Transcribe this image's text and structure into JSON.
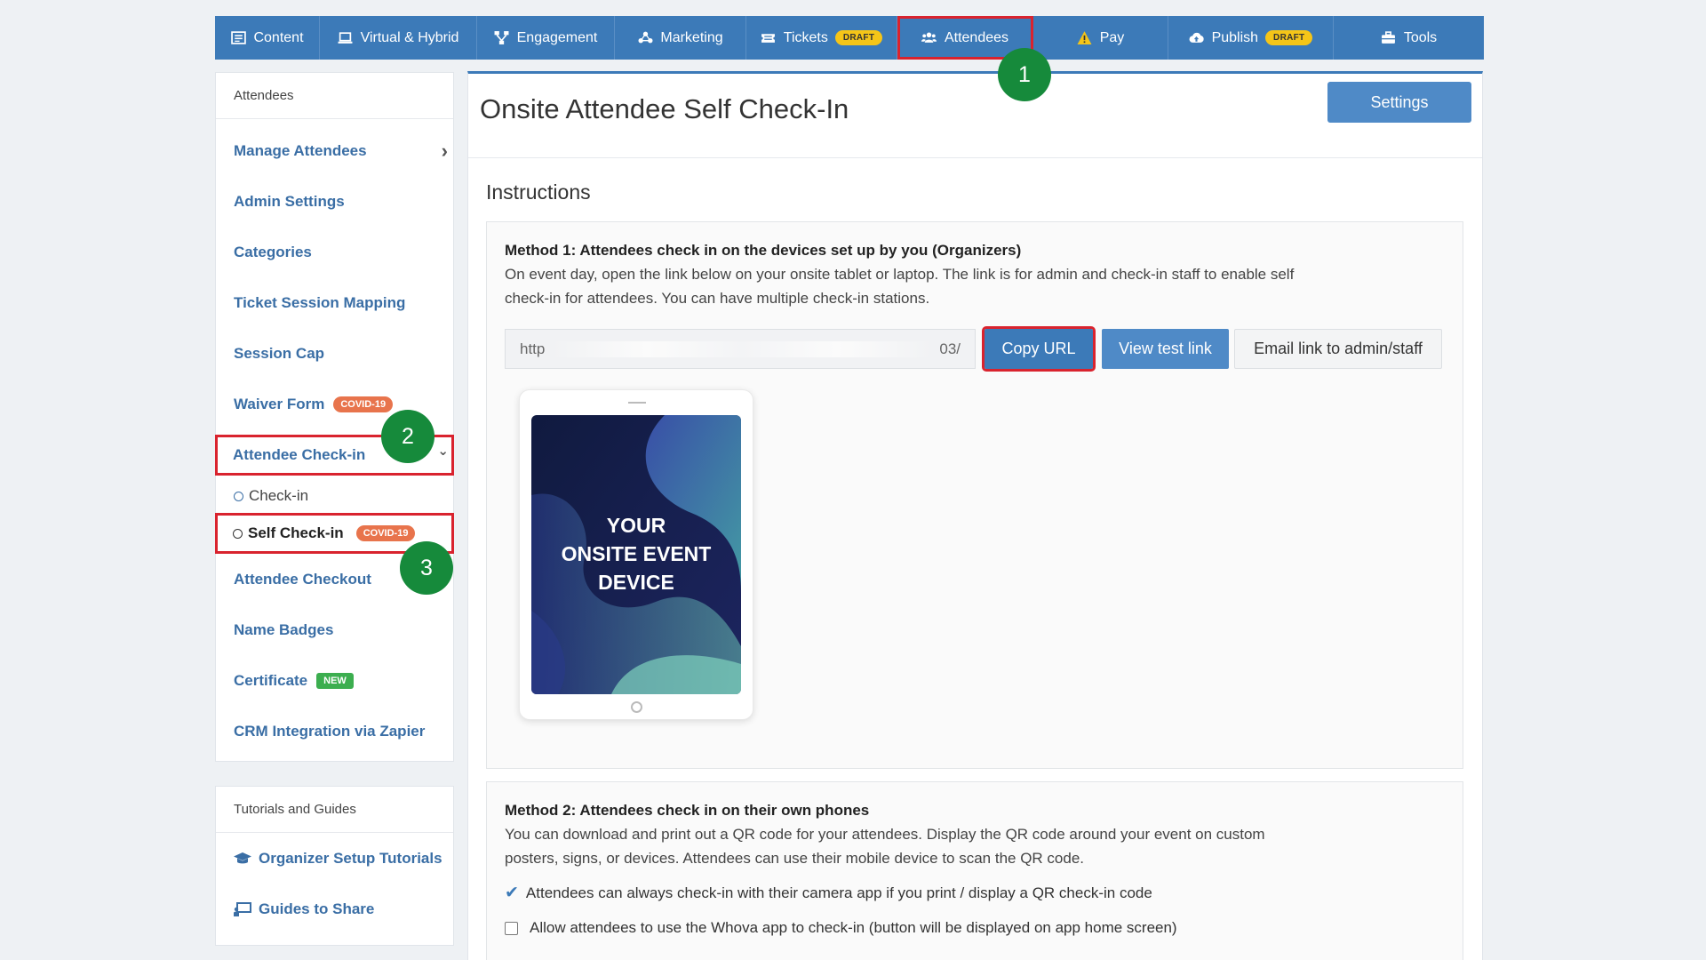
{
  "topnav": {
    "items": [
      {
        "label": "Content",
        "icon": "content-icon"
      },
      {
        "label": "Virtual & Hybrid",
        "icon": "laptop-icon"
      },
      {
        "label": "Engagement",
        "icon": "network-icon"
      },
      {
        "label": "Marketing",
        "icon": "marketing-icon"
      },
      {
        "label": "Tickets",
        "icon": "ticket-icon",
        "badge": "DRAFT"
      },
      {
        "label": "Attendees",
        "icon": "users-icon"
      },
      {
        "label": "Pay",
        "icon": "warning-icon"
      },
      {
        "label": "Publish",
        "icon": "cloud-upload-icon",
        "badge": "DRAFT"
      },
      {
        "label": "Tools",
        "icon": "toolbox-icon"
      }
    ]
  },
  "markers": {
    "one": "1",
    "two": "2",
    "three": "3"
  },
  "sidebar": {
    "header": "Attendees",
    "items": {
      "manage": "Manage Attendees",
      "admin": "Admin Settings",
      "categories": "Categories",
      "ticket_session": "Ticket Session Mapping",
      "session_cap": "Session Cap",
      "waiver": "Waiver Form",
      "waiver_badge": "COVID-19",
      "checkin_group": "Attendee Check-in",
      "checkin_sub": "Check-in",
      "self_checkin": "Self Check-in",
      "self_badge": "COVID-19",
      "checkout": "Attendee Checkout",
      "badges": "Name Badges",
      "certificate": "Certificate",
      "certificate_badge": "NEW",
      "crm": "CRM Integration via Zapier"
    },
    "chevron_right": "›",
    "chevron_down": "⌄"
  },
  "tutorials": {
    "header": "Tutorials and Guides",
    "setup": "Organizer Setup Tutorials",
    "guides": "Guides to Share"
  },
  "main": {
    "title": "Onsite Attendee Self Check-In",
    "settings": "Settings",
    "instructions": "Instructions",
    "method1": {
      "title": "Method 1: Attendees check in on the devices set up by you (Organizers)",
      "desc": "On event day, open the link below on your onsite tablet or laptop. The link is for admin and check-in staff to enable self check-in for attendees. You can have multiple check-in stations.",
      "url_start": "http",
      "url_end": "03/",
      "copy": "Copy URL",
      "view": "View test link",
      "email": "Email link to admin/staff",
      "device_line1": "YOUR",
      "device_line2": "ONSITE EVENT",
      "device_line3": "DEVICE"
    },
    "method2": {
      "title": "Method 2: Attendees check in on their own phones",
      "desc": "You can download and print out a QR code for your attendees. Display the QR code around your event on custom posters, signs, or devices. Attendees can use their mobile device to scan the QR code.",
      "check1": "Attendees can always check-in with their camera app if you print / display a QR check-in code",
      "check2": "Allow attendees to use the Whova app to check-in (button will be displayed on app home screen)"
    }
  },
  "colors": {
    "nav": "#3c7ab8",
    "link": "#3a6ea5",
    "highlight": "#d9232e",
    "marker": "#168a3b",
    "covid": "#e8744c",
    "new": "#3cae4f",
    "draft": "#f5c518"
  }
}
